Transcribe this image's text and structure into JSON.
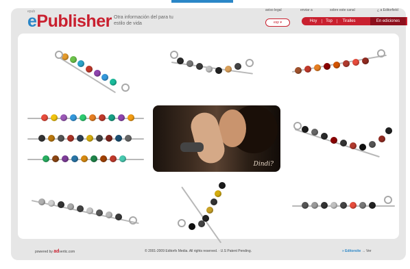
{
  "header": {
    "brand_small": "epub",
    "logo_e": "e",
    "logo_rest": "Publisher",
    "tagline": "Otra información del para tu estilo de vida",
    "top_links": [
      "aviso legal",
      "enviar a",
      "sobre este canal",
      "¿ a Editorfield"
    ],
    "language": "esp ▾",
    "tabs": [
      "Hoy",
      "Top",
      "Tiralles",
      "En ediciones"
    ]
  },
  "photo": {
    "signature": "Dindi?"
  },
  "footer": {
    "powered_prefix": "powered by",
    "powered_brand": "ad",
    "powered_suffix": "vertic.com",
    "copyright": "© 2001-2009 Editorfx Media. All rights reserved. · U.S Patent Pending.",
    "right_brand": "» Editorsite",
    "right_suffix": "→ Ver"
  },
  "colors": {
    "brand_red": "#c9202f",
    "brand_blue": "#2a86c7",
    "frame_gray": "#e6e6e6"
  }
}
